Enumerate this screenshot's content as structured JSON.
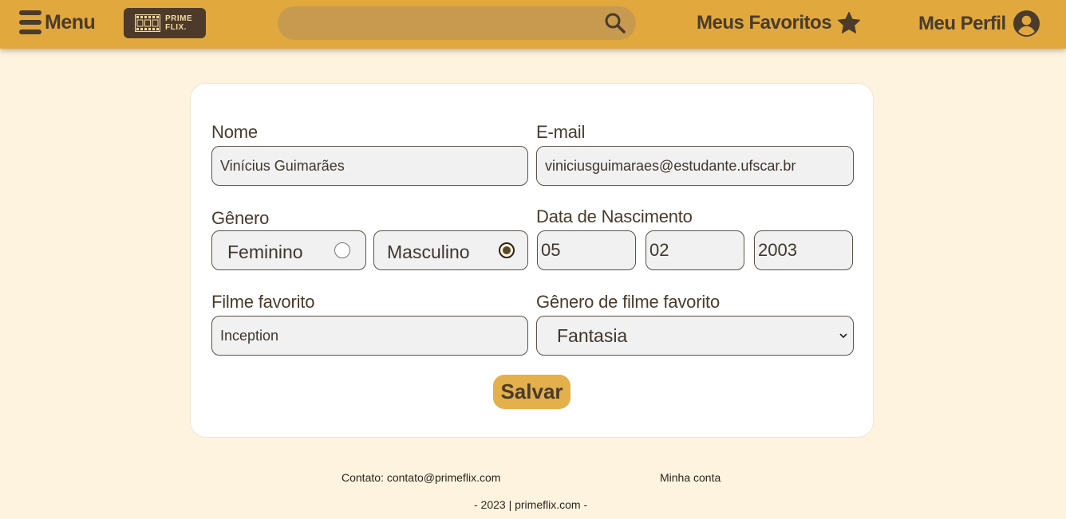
{
  "header": {
    "menu_label": "Menu",
    "logo_text_line1": "PRIME",
    "logo_text_line2": "FLIX.",
    "search_placeholder": "",
    "favorites_label": "Meus Favoritos",
    "profile_label": "Meu Perfil"
  },
  "form": {
    "name_label": "Nome",
    "name_value": "Vinícius Guimarães",
    "email_label": "E-mail",
    "email_value": "viniciusguimaraes@estudante.ufscar.br",
    "gender_label": "Gênero",
    "gender_options": [
      "Feminino",
      "Masculino"
    ],
    "gender_selected": "Masculino",
    "birth_label": "Data de Nascimento",
    "birth_day": "05",
    "birth_month": "02",
    "birth_year": "2003",
    "movie_label": "Filme favorito",
    "movie_value": "Inception",
    "genre_label": "Gênero de filme favorito",
    "genre_value": "Fantasia",
    "save_label": "Salvar"
  },
  "footer": {
    "contact_label": "Contato:",
    "contact_email": "contato@primeflix.com",
    "account_link": "Minha conta",
    "copyright": "- 2023 | primeflix.com -"
  },
  "colors": {
    "header_bg": "#e0a83d",
    "page_bg": "#fef3de",
    "accent": "#e4b04c",
    "text": "#4a3b2b"
  },
  "icons": [
    "menu-icon",
    "film-icon",
    "search-icon",
    "star-icon",
    "user-circle-icon",
    "chevron-down-icon"
  ]
}
